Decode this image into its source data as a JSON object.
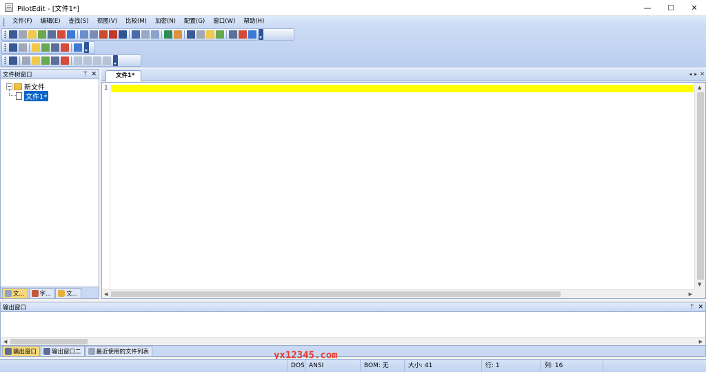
{
  "window": {
    "title": "PilotEdit - [文件1*]",
    "controls": {
      "minimize": "—",
      "maximize": "☐",
      "close": "✕"
    }
  },
  "menu": {
    "items": [
      "文件(F)",
      "编辑(E)",
      "查找(S)",
      "视图(V)",
      "比较(M)",
      "加密(N)",
      "配置(G)",
      "窗口(W)",
      "帮助(H)"
    ]
  },
  "toolbars": {
    "row1_icons": [
      "new-file-icon",
      "open-icon",
      "save-icon",
      "save-all-icon",
      "print-icon",
      "close-file-icon",
      "delete-icon",
      "undo-icon",
      "redo-icon",
      "cut-icon",
      "copy-icon",
      "paste-icon",
      "find-icon",
      "replace-icon",
      "goto-icon",
      "indent-icon",
      "outdent-icon",
      "bookmark-icon",
      "compare-icon",
      "compare-left-icon",
      "compare-right-icon",
      "settings-icon",
      "zoom-icon",
      "help-icon"
    ],
    "row2_icons": [
      "project-icon",
      "open-project-icon",
      "ftp-icon",
      "server-icon",
      "terminal-icon",
      "download-icon",
      "lock-icon"
    ],
    "row3_icons": [
      "column-icon",
      "format-icon",
      "web-icon",
      "sort-icon",
      "up-icon",
      "wrap-icon",
      "disabled-icon",
      "disabled-icon",
      "disabled-icon",
      "disabled-icon"
    ]
  },
  "left_panel": {
    "title": "文件树窗口",
    "pin": "ᛘ",
    "close": "✕",
    "tree": {
      "root_toggle": "−",
      "root_label": "新文件",
      "child_label": "文件1*"
    },
    "tabs": [
      "文...",
      "字...",
      "文..."
    ]
  },
  "editor": {
    "tab_label": "文件1*",
    "line_number": "1",
    "tab_nav": {
      "prev": "◂",
      "next": "▸",
      "close": "✕"
    },
    "scroll": {
      "up": "▲",
      "down": "▼",
      "left": "◀",
      "right": "▶"
    }
  },
  "output_panel": {
    "title": "输出窗口",
    "pin": "ᛘ",
    "close": "✕",
    "scroll": {
      "left": "◀",
      "right": "▶"
    },
    "tabs": [
      "输出窗口",
      "输出窗口二",
      "最近使用的文件列表"
    ]
  },
  "statusbar": {
    "line_ending": "DOS",
    "encoding": "ANSI",
    "bom": "BOM: 无",
    "size": "大小: 41",
    "row": "行: 1",
    "col": "列: 16"
  },
  "watermark": "yx12345.com",
  "colors": {
    "current_line": "#ffff00",
    "selection": "#0a64c8",
    "watermark": "#e83a2a"
  }
}
